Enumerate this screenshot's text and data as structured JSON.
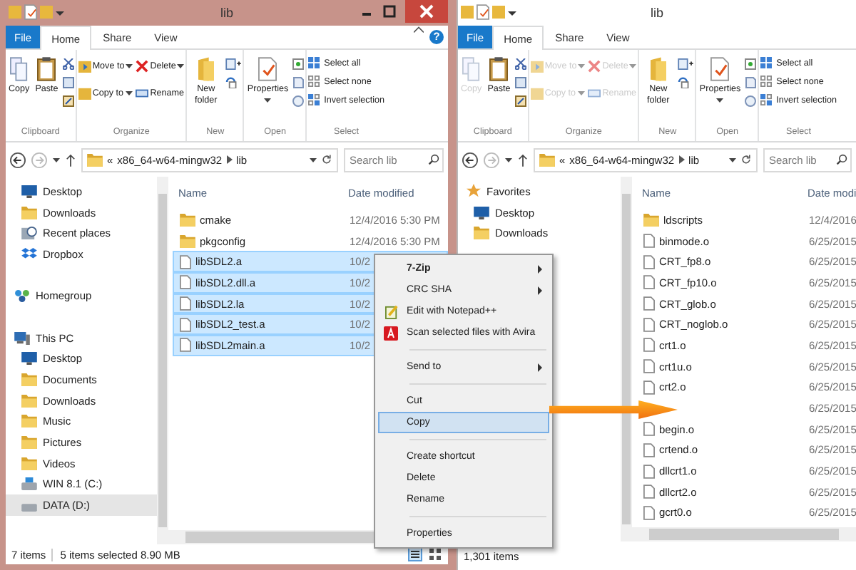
{
  "windows": [
    {
      "title": "lib",
      "active": true,
      "ribbon": {
        "tabs": [
          {
            "label": "File",
            "kind": "file",
            "selected": false
          },
          {
            "label": "Home",
            "kind": "tab",
            "selected": true
          },
          {
            "label": "Share",
            "kind": "tab",
            "selected": false
          },
          {
            "label": "View",
            "kind": "tab",
            "selected": false
          }
        ],
        "help": "?",
        "clipboard": {
          "label": "Clipboard",
          "copy": {
            "label": "Copy",
            "disabled": false
          },
          "paste": {
            "label": "Paste",
            "disabled": false
          }
        },
        "organize": {
          "label": "Organize",
          "move_to": {
            "label": "Move to",
            "disabled": false
          },
          "copy_to": {
            "label": "Copy to",
            "disabled": false
          },
          "delete": {
            "label": "Delete",
            "disabled": false
          },
          "rename": {
            "label": "Rename",
            "disabled": false
          }
        },
        "new": {
          "label": "New",
          "new_folder": "New folder"
        },
        "open": {
          "label": "Open",
          "properties": "Properties"
        },
        "select": {
          "label": "Select",
          "select_all": "Select all",
          "select_none": "Select none",
          "invert_selection": "Invert selection"
        }
      },
      "address": {
        "overflow": "«",
        "folders": [
          "x86_64-w64-mingw32",
          "lib"
        ],
        "search": {
          "placeholder": "Search lib"
        }
      },
      "nav": [
        {
          "children": [
            {
              "label": "Desktop",
              "kind": "desktop",
              "selected": false
            },
            {
              "label": "Downloads",
              "kind": "folder",
              "selected": false
            },
            {
              "label": "Recent places",
              "kind": "recent",
              "selected": false
            },
            {
              "label": "Dropbox",
              "kind": "dropbox",
              "selected": false
            }
          ]
        },
        {
          "label": "Homegroup",
          "kind": "homegroup",
          "selected": false
        },
        {
          "label": "This PC",
          "kind": "pc",
          "selected": false,
          "children": [
            {
              "label": "Desktop",
              "kind": "desktop",
              "selected": false
            },
            {
              "label": "Documents",
              "kind": "folder",
              "selected": false
            },
            {
              "label": "Downloads",
              "kind": "folder",
              "selected": false
            },
            {
              "label": "Music",
              "kind": "folder",
              "selected": false
            },
            {
              "label": "Pictures",
              "kind": "folder",
              "selected": false
            },
            {
              "label": "Videos",
              "kind": "folder",
              "selected": false
            },
            {
              "label": "WIN 8.1 (C:)",
              "kind": "system_drive",
              "selected": false
            },
            {
              "label": "DATA (D:)",
              "kind": "drive",
              "selected": true
            }
          ]
        }
      ],
      "columns": [
        "Name",
        "Date modified"
      ],
      "files": [
        {
          "name": "cmake",
          "kind": "folder",
          "date": "12/4/2016 5:30 PM",
          "selected": false
        },
        {
          "name": "pkgconfig",
          "kind": "folder",
          "date": "12/4/2016 5:30 PM",
          "selected": false
        },
        {
          "name": "libSDL2.a",
          "kind": "file",
          "date": "10/2",
          "selected": true
        },
        {
          "name": "libSDL2.dll.a",
          "kind": "file",
          "date": "10/2",
          "selected": true
        },
        {
          "name": "libSDL2.la",
          "kind": "file",
          "date": "10/2",
          "selected": true
        },
        {
          "name": "libSDL2_test.a",
          "kind": "file",
          "date": "10/2",
          "selected": true
        },
        {
          "name": "libSDL2main.a",
          "kind": "file",
          "date": "10/2",
          "selected": true
        }
      ],
      "status": {
        "items": "7 items",
        "selection": "5 items selected  8.90 MB"
      }
    },
    {
      "title": "lib",
      "active": false,
      "ribbon": {
        "tabs": [
          {
            "label": "File",
            "kind": "file",
            "selected": false
          },
          {
            "label": "Home",
            "kind": "tab",
            "selected": true
          },
          {
            "label": "Share",
            "kind": "tab",
            "selected": false
          },
          {
            "label": "View",
            "kind": "tab",
            "selected": false
          }
        ],
        "clipboard": {
          "label": "Clipboard",
          "copy": {
            "label": "Copy",
            "disabled": true
          },
          "paste": {
            "label": "Paste",
            "disabled": false
          }
        },
        "organize": {
          "label": "Organize",
          "move_to": {
            "label": "Move to",
            "disabled": true
          },
          "copy_to": {
            "label": "Copy to",
            "disabled": true
          },
          "delete": {
            "label": "Delete",
            "disabled": true
          },
          "rename": {
            "label": "Rename",
            "disabled": true
          }
        },
        "new": {
          "label": "New",
          "new_folder": "New folder"
        },
        "open": {
          "label": "Open",
          "properties": "Properties"
        },
        "select": {
          "label": "Select",
          "select_all": "Select all",
          "select_none": "Select none",
          "invert_selection": "Invert selection"
        }
      },
      "address": {
        "overflow": "«",
        "folders": [
          "x86_64-w64-mingw32",
          "lib"
        ],
        "search": {
          "placeholder": "Search lib"
        }
      },
      "nav": [
        {
          "label": "Favorites",
          "kind": "star",
          "selected": false,
          "children": [
            {
              "label": "Desktop",
              "kind": "desktop",
              "selected": false
            },
            {
              "label": "Downloads",
              "kind": "folder",
              "selected": false
            }
          ]
        }
      ],
      "columns": [
        "Name",
        "Date modi"
      ],
      "files": [
        {
          "name": "ldscripts",
          "kind": "folder",
          "date": "12/4/2016",
          "selected": false
        },
        {
          "name": "binmode.o",
          "kind": "file",
          "date": "6/25/2015",
          "selected": false
        },
        {
          "name": "CRT_fp8.o",
          "kind": "file",
          "date": "6/25/2015",
          "selected": false
        },
        {
          "name": "CRT_fp10.o",
          "kind": "file",
          "date": "6/25/2015",
          "selected": false
        },
        {
          "name": "CRT_glob.o",
          "kind": "file",
          "date": "6/25/2015",
          "selected": false
        },
        {
          "name": "CRT_noglob.o",
          "kind": "file",
          "date": "6/25/2015",
          "selected": false
        },
        {
          "name": "crt1.o",
          "kind": "file",
          "date": "6/25/2015",
          "selected": false
        },
        {
          "name": "crt1u.o",
          "kind": "file",
          "date": "6/25/2015",
          "selected": false
        },
        {
          "name": "crt2.o",
          "kind": "file",
          "date": "6/25/2015",
          "selected": false
        },
        {
          "date": "6/25/2015",
          "selected": false
        },
        {
          "name": "begin.o",
          "kind": "file",
          "date": "6/25/2015",
          "selected": false
        },
        {
          "name": "crtend.o",
          "kind": "file",
          "date": "6/25/2015",
          "selected": false
        },
        {
          "name": "dllcrt1.o",
          "kind": "file",
          "date": "6/25/2015",
          "selected": false
        },
        {
          "name": "dllcrt2.o",
          "kind": "file",
          "date": "6/25/2015",
          "selected": false
        },
        {
          "name": "gcrt0.o",
          "kind": "file",
          "date": "6/25/2015",
          "selected": false
        }
      ],
      "status": {
        "items": "1,301 items"
      }
    }
  ],
  "context_menu": {
    "groups": [
      [
        {
          "label": "7-Zip",
          "kind": "plain",
          "bold": true,
          "submenu": true,
          "selected": false
        },
        {
          "label": "CRC SHA",
          "kind": "plain",
          "bold": false,
          "submenu": true,
          "selected": false
        },
        {
          "label": "Edit with Notepad++",
          "kind": "editor",
          "bold": false,
          "submenu": false,
          "selected": false
        },
        {
          "label": "Scan selected files with Avira",
          "kind": "scanner",
          "bold": false,
          "submenu": false,
          "selected": false
        }
      ],
      [
        {
          "label": "Send to",
          "kind": "plain",
          "bold": false,
          "submenu": true,
          "selected": false
        }
      ],
      [
        {
          "label": "Cut",
          "kind": "plain",
          "bold": false,
          "submenu": false,
          "selected": false
        },
        {
          "label": "Copy",
          "kind": "plain",
          "bold": false,
          "submenu": false,
          "selected": true
        }
      ],
      [
        {
          "label": "Create shortcut",
          "kind": "plain",
          "bold": false,
          "submenu": false,
          "selected": false
        },
        {
          "label": "Delete",
          "kind": "plain",
          "bold": false,
          "submenu": false,
          "selected": false
        },
        {
          "label": "Rename",
          "kind": "plain",
          "bold": false,
          "submenu": false,
          "selected": false
        }
      ],
      [
        {
          "label": "Properties",
          "kind": "plain",
          "bold": false,
          "submenu": false,
          "selected": false
        }
      ]
    ]
  }
}
